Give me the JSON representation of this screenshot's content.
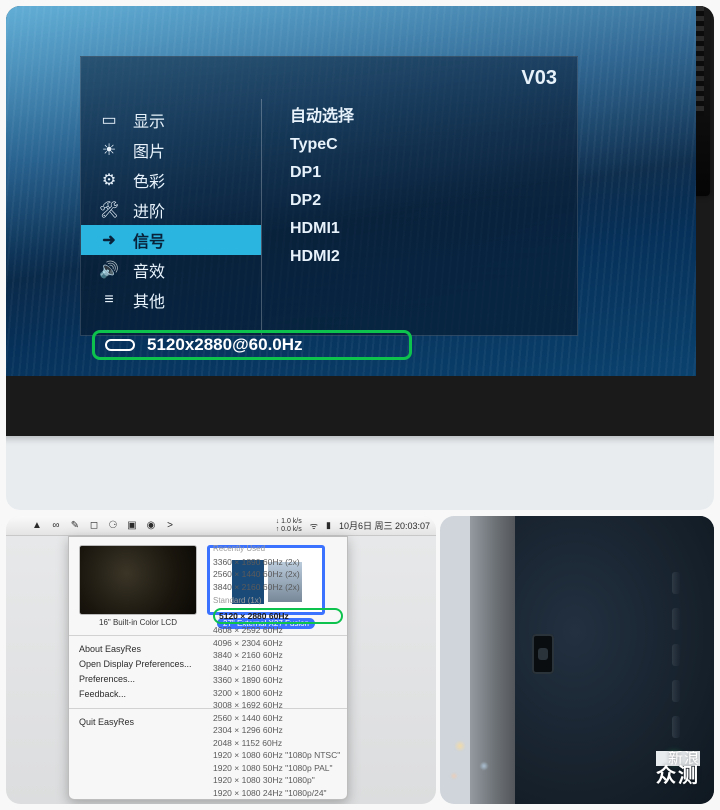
{
  "osd": {
    "title": "V03",
    "menu": [
      {
        "icon": "▭",
        "label": "显示"
      },
      {
        "icon": "☀",
        "label": "图片"
      },
      {
        "icon": "⚙",
        "label": "色彩"
      },
      {
        "icon": "🛠",
        "label": "进阶"
      },
      {
        "icon": "➜",
        "label": "信号",
        "selected": true
      },
      {
        "icon": "🔊",
        "label": "音效"
      },
      {
        "icon": "≡",
        "label": "其他"
      }
    ],
    "options": [
      "自动选择",
      "TypeC",
      "DP1",
      "DP2",
      "HDMI1",
      "HDMI2"
    ],
    "status": "5120x2880@60.0Hz"
  },
  "mac": {
    "menubar_icons": [
      "",
      "▲",
      "∞",
      "✎",
      "◻",
      "⚆",
      "▣",
      "◉",
      ">"
    ],
    "menubar_right": {
      "net": "↓ 1.0 k/s\n↑ 0.0 k/s",
      "wifi": "ᯤ",
      "battery": "▮",
      "date": "10月6日 周三 20:03:07"
    },
    "thumbs": [
      {
        "label": "16\" Built-in Color LCD"
      },
      {
        "label": "27\" External X27 Fusion",
        "selected": true
      }
    ],
    "menu_items": [
      "About EasyRes",
      "Open Display Preferences...",
      "Preferences...",
      "Feedback..."
    ],
    "quit": "Quit EasyRes",
    "reslist": {
      "recent_header": "Recently Used",
      "recent": [
        "3360 × 1890  60Hz  (2x)",
        "2560 × 1440  60Hz  (2x)",
        "3840 × 2160  60Hz  (2x)"
      ],
      "standard_header": "Standard (1x)",
      "standard": [
        "5120 × 2880  60Hz",
        "4608 × 2592  60Hz",
        "4096 × 2304  60Hz",
        "3840 × 2160  60Hz",
        "3840 × 2160  60Hz",
        "3360 × 1890  60Hz",
        "3200 × 1800  60Hz",
        "3008 × 1692  60Hz",
        "2560 × 1440  60Hz",
        "2304 × 1296  60Hz",
        "2048 × 1152  60Hz",
        "1920 × 1080  60Hz  \"1080p NTSC\"",
        "1920 × 1080  50Hz  \"1080p PAL\"",
        "1920 × 1080  30Hz  \"1080p\"",
        "1920 × 1080  24Hz  \"1080p/24\""
      ],
      "highlight_index": 0
    }
  },
  "watermark": {
    "line1": "新浪",
    "line2": "众测"
  }
}
